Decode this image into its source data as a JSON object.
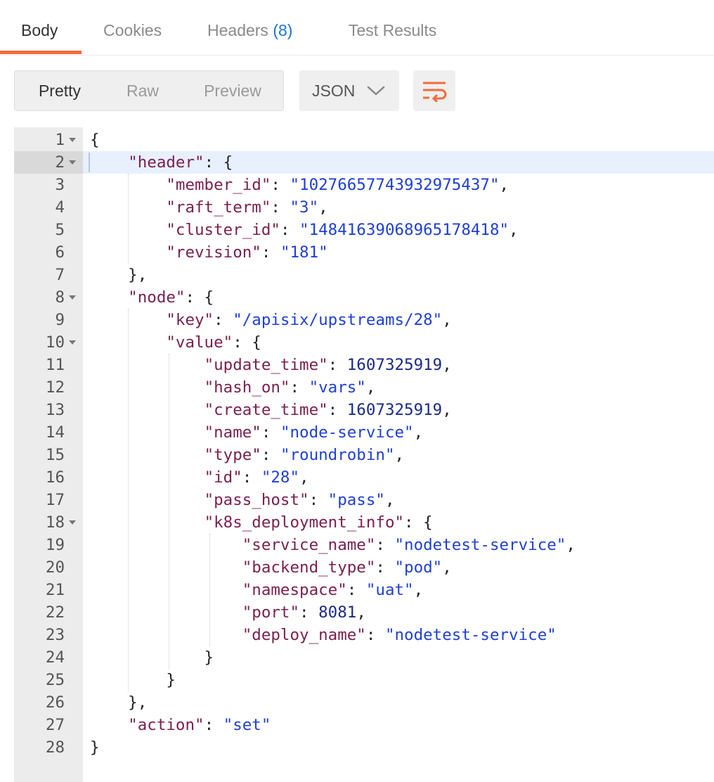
{
  "tabs": [
    {
      "label": "Body",
      "active": true
    },
    {
      "label": "Cookies"
    },
    {
      "label": "Headers",
      "count": "(8)"
    },
    {
      "label": "Test Results"
    }
  ],
  "view_modes": [
    "Pretty",
    "Raw",
    "Preview"
  ],
  "format_select": {
    "value": "JSON"
  },
  "icons": {
    "wrap": "wrap-lines-icon",
    "chevron": "chevron-down-icon"
  },
  "colors": {
    "accent": "#f26b3a",
    "key": "#7a1f4f",
    "string": "#1f3fd6",
    "number": "#1a2a8a",
    "count": "#1f73d8"
  },
  "lines": [
    {
      "n": "1",
      "tokens": [
        [
          "p",
          "{"
        ]
      ],
      "fold": true
    },
    {
      "n": "2",
      "tokens": [
        [
          "p",
          "    "
        ],
        [
          "k",
          "\"header\""
        ],
        [
          "p",
          ": {"
        ]
      ],
      "fold": true,
      "active": true
    },
    {
      "n": "3",
      "tokens": [
        [
          "p",
          "        "
        ],
        [
          "k",
          "\"member_id\""
        ],
        [
          "p",
          ": "
        ],
        [
          "s",
          "\"10276657743932975437\""
        ],
        [
          "p",
          ","
        ]
      ]
    },
    {
      "n": "4",
      "tokens": [
        [
          "p",
          "        "
        ],
        [
          "k",
          "\"raft_term\""
        ],
        [
          "p",
          ": "
        ],
        [
          "s",
          "\"3\""
        ],
        [
          "p",
          ","
        ]
      ]
    },
    {
      "n": "5",
      "tokens": [
        [
          "p",
          "        "
        ],
        [
          "k",
          "\"cluster_id\""
        ],
        [
          "p",
          ": "
        ],
        [
          "s",
          "\"14841639068965178418\""
        ],
        [
          "p",
          ","
        ]
      ]
    },
    {
      "n": "6",
      "tokens": [
        [
          "p",
          "        "
        ],
        [
          "k",
          "\"revision\""
        ],
        [
          "p",
          ": "
        ],
        [
          "s",
          "\"181\""
        ]
      ]
    },
    {
      "n": "7",
      "tokens": [
        [
          "p",
          "    },"
        ]
      ]
    },
    {
      "n": "8",
      "tokens": [
        [
          "p",
          "    "
        ],
        [
          "k",
          "\"node\""
        ],
        [
          "p",
          ": {"
        ]
      ],
      "fold": true
    },
    {
      "n": "9",
      "tokens": [
        [
          "p",
          "        "
        ],
        [
          "k",
          "\"key\""
        ],
        [
          "p",
          ": "
        ],
        [
          "s",
          "\"/apisix/upstreams/28\""
        ],
        [
          "p",
          ","
        ]
      ]
    },
    {
      "n": "10",
      "tokens": [
        [
          "p",
          "        "
        ],
        [
          "k",
          "\"value\""
        ],
        [
          "p",
          ": {"
        ]
      ],
      "fold": true
    },
    {
      "n": "11",
      "tokens": [
        [
          "p",
          "            "
        ],
        [
          "k",
          "\"update_time\""
        ],
        [
          "p",
          ": "
        ],
        [
          "n",
          "1607325919"
        ],
        [
          "p",
          ","
        ]
      ]
    },
    {
      "n": "12",
      "tokens": [
        [
          "p",
          "            "
        ],
        [
          "k",
          "\"hash_on\""
        ],
        [
          "p",
          ": "
        ],
        [
          "s",
          "\"vars\""
        ],
        [
          "p",
          ","
        ]
      ]
    },
    {
      "n": "13",
      "tokens": [
        [
          "p",
          "            "
        ],
        [
          "k",
          "\"create_time\""
        ],
        [
          "p",
          ": "
        ],
        [
          "n",
          "1607325919"
        ],
        [
          "p",
          ","
        ]
      ]
    },
    {
      "n": "14",
      "tokens": [
        [
          "p",
          "            "
        ],
        [
          "k",
          "\"name\""
        ],
        [
          "p",
          ": "
        ],
        [
          "s",
          "\"node-service\""
        ],
        [
          "p",
          ","
        ]
      ]
    },
    {
      "n": "15",
      "tokens": [
        [
          "p",
          "            "
        ],
        [
          "k",
          "\"type\""
        ],
        [
          "p",
          ": "
        ],
        [
          "s",
          "\"roundrobin\""
        ],
        [
          "p",
          ","
        ]
      ]
    },
    {
      "n": "16",
      "tokens": [
        [
          "p",
          "            "
        ],
        [
          "k",
          "\"id\""
        ],
        [
          "p",
          ": "
        ],
        [
          "s",
          "\"28\""
        ],
        [
          "p",
          ","
        ]
      ]
    },
    {
      "n": "17",
      "tokens": [
        [
          "p",
          "            "
        ],
        [
          "k",
          "\"pass_host\""
        ],
        [
          "p",
          ": "
        ],
        [
          "s",
          "\"pass\""
        ],
        [
          "p",
          ","
        ]
      ]
    },
    {
      "n": "18",
      "tokens": [
        [
          "p",
          "            "
        ],
        [
          "k",
          "\"k8s_deployment_info\""
        ],
        [
          "p",
          ": {"
        ]
      ],
      "fold": true
    },
    {
      "n": "19",
      "tokens": [
        [
          "p",
          "                "
        ],
        [
          "k",
          "\"service_name\""
        ],
        [
          "p",
          ": "
        ],
        [
          "s",
          "\"nodetest-service\""
        ],
        [
          "p",
          ","
        ]
      ]
    },
    {
      "n": "20",
      "tokens": [
        [
          "p",
          "                "
        ],
        [
          "k",
          "\"backend_type\""
        ],
        [
          "p",
          ": "
        ],
        [
          "s",
          "\"pod\""
        ],
        [
          "p",
          ","
        ]
      ]
    },
    {
      "n": "21",
      "tokens": [
        [
          "p",
          "                "
        ],
        [
          "k",
          "\"namespace\""
        ],
        [
          "p",
          ": "
        ],
        [
          "s",
          "\"uat\""
        ],
        [
          "p",
          ","
        ]
      ]
    },
    {
      "n": "22",
      "tokens": [
        [
          "p",
          "                "
        ],
        [
          "k",
          "\"port\""
        ],
        [
          "p",
          ": "
        ],
        [
          "n",
          "8081"
        ],
        [
          "p",
          ","
        ]
      ]
    },
    {
      "n": "23",
      "tokens": [
        [
          "p",
          "                "
        ],
        [
          "k",
          "\"deploy_name\""
        ],
        [
          "p",
          ": "
        ],
        [
          "s",
          "\"nodetest-service\""
        ]
      ]
    },
    {
      "n": "24",
      "tokens": [
        [
          "p",
          "            }"
        ]
      ]
    },
    {
      "n": "25",
      "tokens": [
        [
          "p",
          "        }"
        ]
      ]
    },
    {
      "n": "26",
      "tokens": [
        [
          "p",
          "    },"
        ]
      ]
    },
    {
      "n": "27",
      "tokens": [
        [
          "p",
          "    "
        ],
        [
          "k",
          "\"action\""
        ],
        [
          "p",
          ": "
        ],
        [
          "s",
          "\"set\""
        ]
      ]
    },
    {
      "n": "28",
      "tokens": [
        [
          "p",
          "}"
        ]
      ]
    }
  ]
}
